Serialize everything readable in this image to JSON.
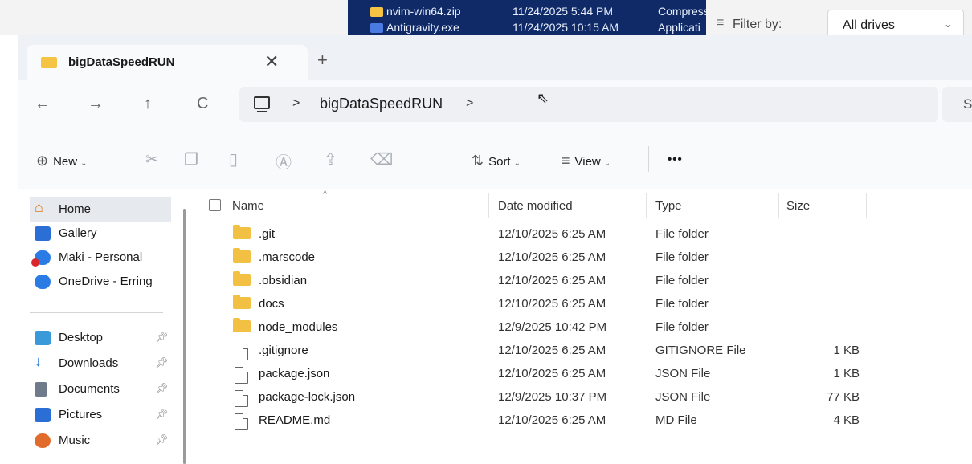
{
  "background_window": {
    "rows": [
      {
        "name": "nvim-win64.zip",
        "date": "11/24/2025 5:44 PM",
        "type": "Compress"
      },
      {
        "name": "Antigravity.exe",
        "date": "11/24/2025 10:15 AM",
        "type": "Applicati"
      }
    ],
    "filter_label": "Filter by:",
    "filter_value": "All drives"
  },
  "tab": {
    "title": "bigDataSpeedRUN",
    "close": "✕",
    "new_tab": "+"
  },
  "address": {
    "back": "←",
    "forward": "→",
    "up": "↑",
    "refresh": "C",
    "separator": ">",
    "crumb": "bigDataSpeedRUN",
    "search_hint": "S"
  },
  "toolbar": {
    "new_label": "New",
    "sort_label": "Sort",
    "view_label": "View",
    "more_label": "•••"
  },
  "nav": {
    "items": [
      {
        "label": "Home",
        "icon": "home-icon"
      },
      {
        "label": "Gallery",
        "icon": "gallery-icon"
      },
      {
        "label": "Maki - Personal",
        "icon": "onedrive-personal-icon"
      },
      {
        "label": "OneDrive - Erring",
        "icon": "onedrive-icon"
      }
    ],
    "quick_access": [
      {
        "label": "Desktop",
        "icon": "desktop-icon"
      },
      {
        "label": "Downloads",
        "icon": "downloads-icon"
      },
      {
        "label": "Documents",
        "icon": "documents-icon"
      },
      {
        "label": "Pictures",
        "icon": "pictures-icon"
      },
      {
        "label": "Music",
        "icon": "music-icon"
      }
    ]
  },
  "list": {
    "columns": {
      "name": "Name",
      "date": "Date modified",
      "type": "Type",
      "size": "Size"
    },
    "rows": [
      {
        "name": ".git",
        "date": "12/10/2025 6:25 AM",
        "type": "File folder",
        "size": "",
        "kind": "folder"
      },
      {
        "name": ".marscode",
        "date": "12/10/2025 6:25 AM",
        "type": "File folder",
        "size": "",
        "kind": "folder"
      },
      {
        "name": ".obsidian",
        "date": "12/10/2025 6:25 AM",
        "type": "File folder",
        "size": "",
        "kind": "folder"
      },
      {
        "name": "docs",
        "date": "12/10/2025 6:25 AM",
        "type": "File folder",
        "size": "",
        "kind": "folder"
      },
      {
        "name": "node_modules",
        "date": "12/9/2025 10:42 PM",
        "type": "File folder",
        "size": "",
        "kind": "folder"
      },
      {
        "name": ".gitignore",
        "date": "12/10/2025 6:25 AM",
        "type": "GITIGNORE File",
        "size": "1 KB",
        "kind": "file"
      },
      {
        "name": "package.json",
        "date": "12/10/2025 6:25 AM",
        "type": "JSON File",
        "size": "1 KB",
        "kind": "file"
      },
      {
        "name": "package-lock.json",
        "date": "12/9/2025 10:37 PM",
        "type": "JSON File",
        "size": "77 KB",
        "kind": "file"
      },
      {
        "name": "README.md",
        "date": "12/10/2025 6:25 AM",
        "type": "MD File",
        "size": "4 KB",
        "kind": "file"
      }
    ]
  }
}
